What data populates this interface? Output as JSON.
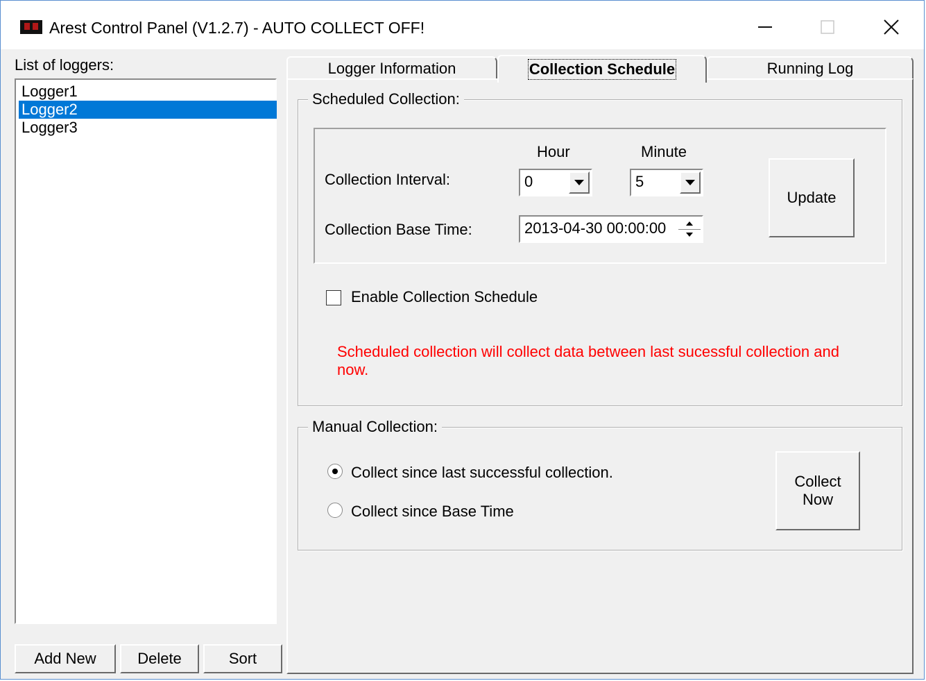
{
  "window": {
    "title": "Arest Control Panel  (V1.2.7) - AUTO COLLECT OFF!",
    "controls": [
      "minimize-icon",
      "maximize-icon",
      "close-icon"
    ]
  },
  "sidebar": {
    "list_label": "List of loggers:",
    "items": [
      {
        "label": "Logger1",
        "selected": false
      },
      {
        "label": "Logger2",
        "selected": true
      },
      {
        "label": "Logger3",
        "selected": false
      }
    ],
    "buttons": {
      "add_new": "Add New",
      "delete": "Delete",
      "sort": "Sort"
    }
  },
  "tabs": [
    {
      "label": "Logger Information",
      "active": false
    },
    {
      "label": "Collection Schedule",
      "active": true
    },
    {
      "label": "Running Log",
      "active": false
    }
  ],
  "scheduled": {
    "legend": "Scheduled Collection:",
    "hour_label": "Hour",
    "minute_label": "Minute",
    "interval_label": "Collection Interval:",
    "hour_value": "0",
    "minute_value": "5",
    "base_time_label": "Collection Base Time:",
    "base_time_value": "2013-04-30 00:00:00",
    "update_label": "Update",
    "enable_label": "Enable Collection Schedule",
    "enable_checked": false,
    "note_line1": "Scheduled collection will collect data between last sucessful collection and",
    "note_line2": "now.",
    "note_color": "#ff0000"
  },
  "manual": {
    "legend": "Manual Collection:",
    "option1": "Collect since last successful collection.",
    "option2": "Collect since Base Time",
    "selected_option": 1,
    "collect_now_line1": "Collect",
    "collect_now_line2": "Now"
  }
}
